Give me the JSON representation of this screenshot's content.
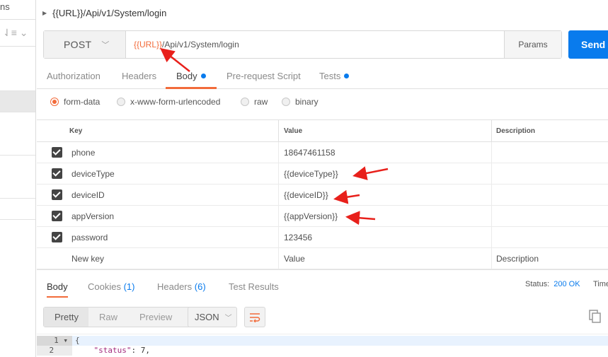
{
  "sidebar": {
    "top_text": "ns",
    "sort_icon": "sort-desc-icon"
  },
  "request": {
    "title": "{{URL}}/Api/v1/System/login",
    "method": "POST",
    "url_var": "{{URL}}",
    "url_path": "/Api/v1/System/login",
    "params_label": "Params",
    "send_label": "Send"
  },
  "req_tabs": [
    {
      "label": "Authorization"
    },
    {
      "label": "Headers"
    },
    {
      "label": "Body"
    },
    {
      "label": "Pre-request Script"
    },
    {
      "label": "Tests"
    }
  ],
  "body_types": [
    "form-data",
    "x-www-form-urlencoded",
    "raw",
    "binary"
  ],
  "table": {
    "headers": {
      "key": "Key",
      "value": "Value",
      "description": "Description"
    },
    "rows": [
      {
        "key": "phone",
        "value": "18647461158"
      },
      {
        "key": "deviceType",
        "value": "{{deviceType}}"
      },
      {
        "key": "deviceID",
        "value": "{{deviceID}}"
      },
      {
        "key": "appVersion",
        "value": "{{appVersion}}"
      },
      {
        "key": "password",
        "value": "123456"
      }
    ],
    "new_key_placeholder": "New key",
    "value_placeholder": "Value",
    "description_placeholder": "Description"
  },
  "response": {
    "tabs": {
      "body": "Body",
      "cookies": "Cookies",
      "cookies_count": "(1)",
      "headers": "Headers",
      "headers_count": "(6)",
      "tests": "Test Results"
    },
    "status_label": "Status:",
    "status_value": "200 OK",
    "time_label": "Time",
    "views": [
      "Pretty",
      "Raw",
      "Preview"
    ],
    "format": "JSON",
    "code": [
      {
        "num": "1",
        "text": "{"
      },
      {
        "num": "2",
        "key": "\"status\"",
        "rest": ": 7,"
      }
    ]
  },
  "colors": {
    "accent": "#f26b3a",
    "send": "#097bed",
    "annotation_arrow": "#e8201b"
  }
}
